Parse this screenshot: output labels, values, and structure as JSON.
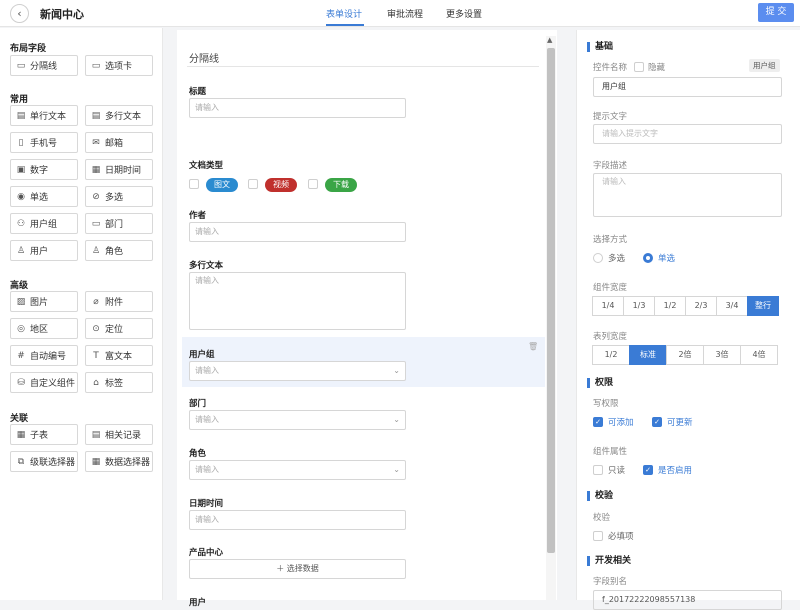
{
  "header": {
    "title": "新闻中心",
    "tabs": [
      "表单设计",
      "审批流程",
      "更多设置"
    ],
    "submit": "提 交"
  },
  "palette": {
    "sections": [
      "布局字段",
      "常用",
      "高级",
      "关联"
    ],
    "items": [
      "分隔线",
      "选项卡",
      "单行文本",
      "多行文本",
      "手机号",
      "邮箱",
      "数字",
      "日期时间",
      "单选",
      "多选",
      "用户组",
      "部门",
      "用户",
      "角色",
      "图片",
      "附件",
      "地区",
      "定位",
      "自动编号",
      "富文本",
      "自定义组件",
      "标签",
      "子表",
      "相关记录",
      "级联选择器",
      "数据选择器"
    ]
  },
  "canvas": {
    "divider_title": "分隔线",
    "f_title": "标题",
    "f_title_ph": "请输入",
    "f_doctype": "文档类型",
    "doctype_options": [
      "图文",
      "视频",
      "下载"
    ],
    "f_author": "作者",
    "f_author_ph": "请输入",
    "f_multiline": "多行文本",
    "f_multiline_ph": "请输入",
    "f_usergroup": "用户组",
    "f_usergroup_ph": "请输入",
    "f_dept": "部门",
    "f_dept_ph": "请输入",
    "f_role": "角色",
    "f_role_ph": "请输入",
    "f_datetime": "日期时间",
    "f_datetime_ph": "请输入",
    "f_product": "产品中心",
    "product_btn": "＋ 选择数据",
    "f_last": "用户"
  },
  "props": {
    "basic": "基础",
    "name_label": "控件名称",
    "hide_label": "隐藏",
    "type_tag": "用户组",
    "name_value": "用户组",
    "hint_label": "提示文字",
    "hint_ph": "请输入提示文字",
    "desc_label": "字段描述",
    "desc_ph": "请输入",
    "mode_label": "选择方式",
    "mode_multi": "多选",
    "mode_single": "单选",
    "width_label": "组件宽度",
    "widths": [
      "1/4",
      "1/3",
      "1/2",
      "2/3",
      "3/4",
      "整行"
    ],
    "colwidth_label": "表列宽度",
    "colwidths": [
      "1/2",
      "标准",
      "2倍",
      "3倍",
      "4倍"
    ],
    "perm": "权限",
    "write_label": "写权限",
    "can_add": "可添加",
    "can_update": "可更新",
    "attr_label": "组件属性",
    "readonly": "只读",
    "enabled": "是否启用",
    "validate": "校验",
    "validate_label": "校验",
    "required": "必填项",
    "dev": "开发相关",
    "alias_label": "字段别名",
    "alias_value": "f_20172222098557138"
  }
}
